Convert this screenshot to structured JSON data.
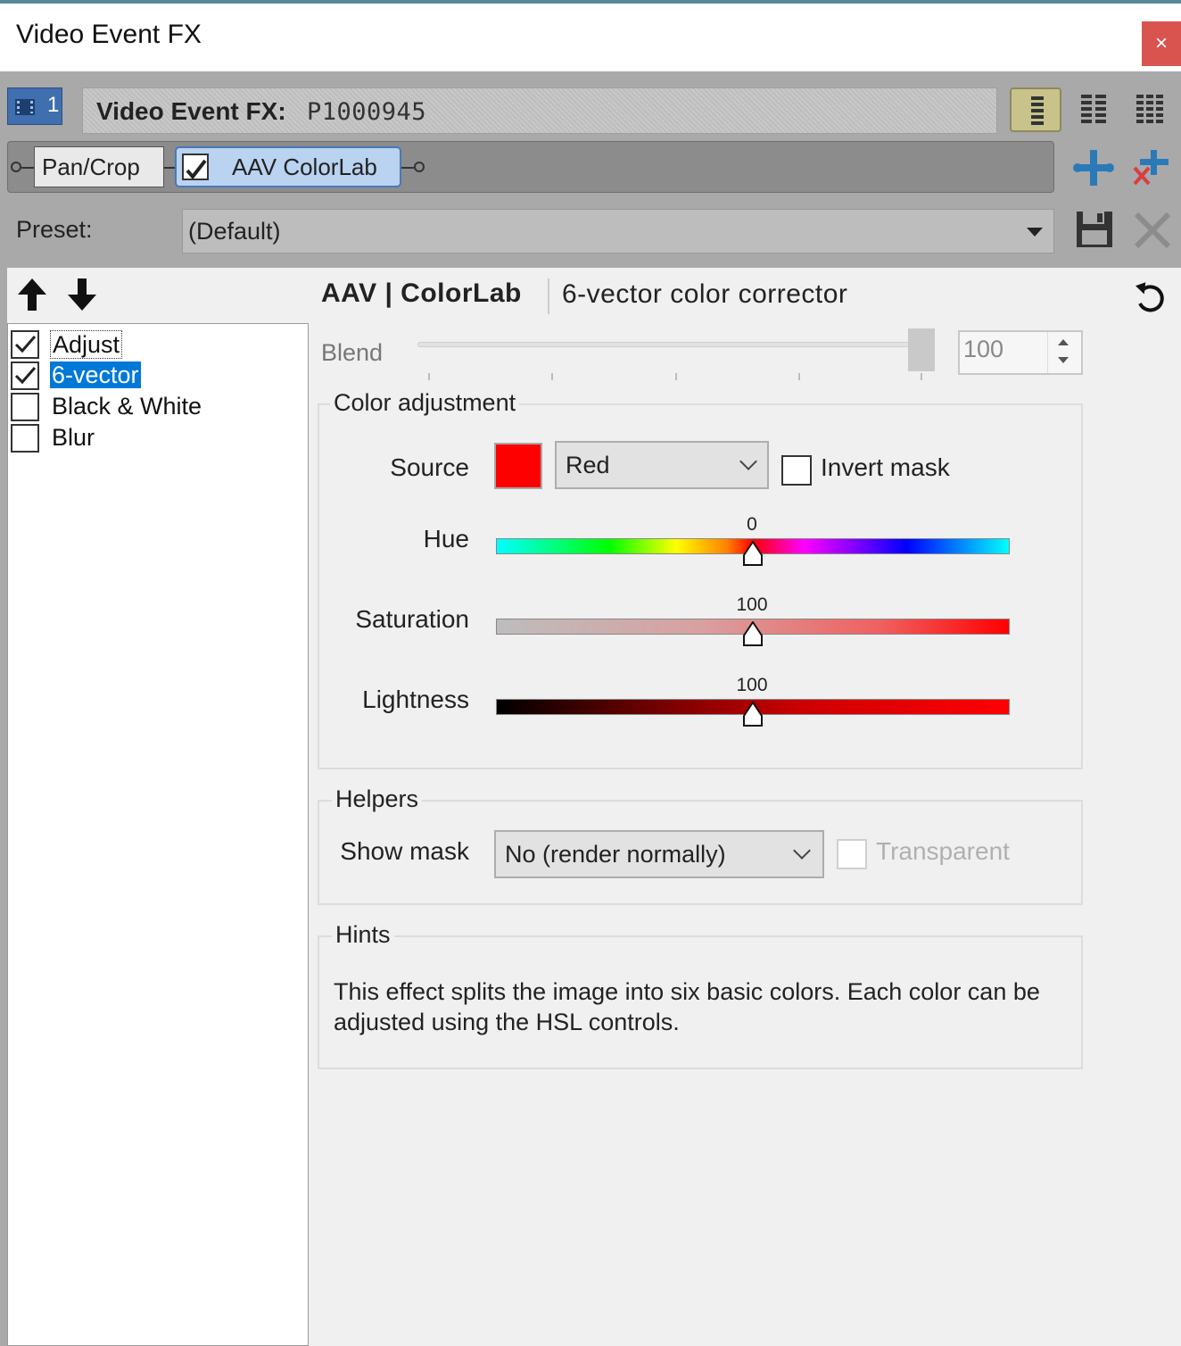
{
  "window": {
    "title": "Video Event FX",
    "close_label": "×"
  },
  "header": {
    "track_number": "1",
    "fx_label": "Video Event FX:",
    "event_name": "P1000945"
  },
  "chain": {
    "plugins": [
      "Pan/Crop",
      "AAV ColorLab"
    ],
    "active_plugin": "AAV ColorLab"
  },
  "preset": {
    "label": "Preset:",
    "value": "(Default)"
  },
  "effects_list": [
    {
      "label": "Adjust",
      "checked": true
    },
    {
      "label": "6-vector",
      "checked": true,
      "selected": true
    },
    {
      "label": "Black & White",
      "checked": false
    },
    {
      "label": "Blur",
      "checked": false
    }
  ],
  "plugin": {
    "brand": "AAV | ColorLab",
    "description": "6-vector color corrector"
  },
  "blend": {
    "label": "Blend",
    "value": "100"
  },
  "color_adjustment": {
    "title": "Color adjustment",
    "source_label": "Source",
    "source_value": "Red",
    "source_color": "#ff0000",
    "invert_mask_label": "Invert mask",
    "invert_mask_checked": false,
    "hue": {
      "label": "Hue",
      "value": "0"
    },
    "saturation": {
      "label": "Saturation",
      "value": "100"
    },
    "lightness": {
      "label": "Lightness",
      "value": "100"
    }
  },
  "helpers": {
    "title": "Helpers",
    "show_mask_label": "Show mask",
    "show_mask_value": "No (render normally)",
    "transparent_label": "Transparent",
    "transparent_checked": false
  },
  "hints": {
    "title": "Hints",
    "text": "This effect splits the image into six basic colors. Each color can be adjusted using the HSL controls."
  },
  "colors": {
    "accent": "#0078d7",
    "close_button": "#d9534f",
    "plugin_active": "#b9d3f0"
  }
}
